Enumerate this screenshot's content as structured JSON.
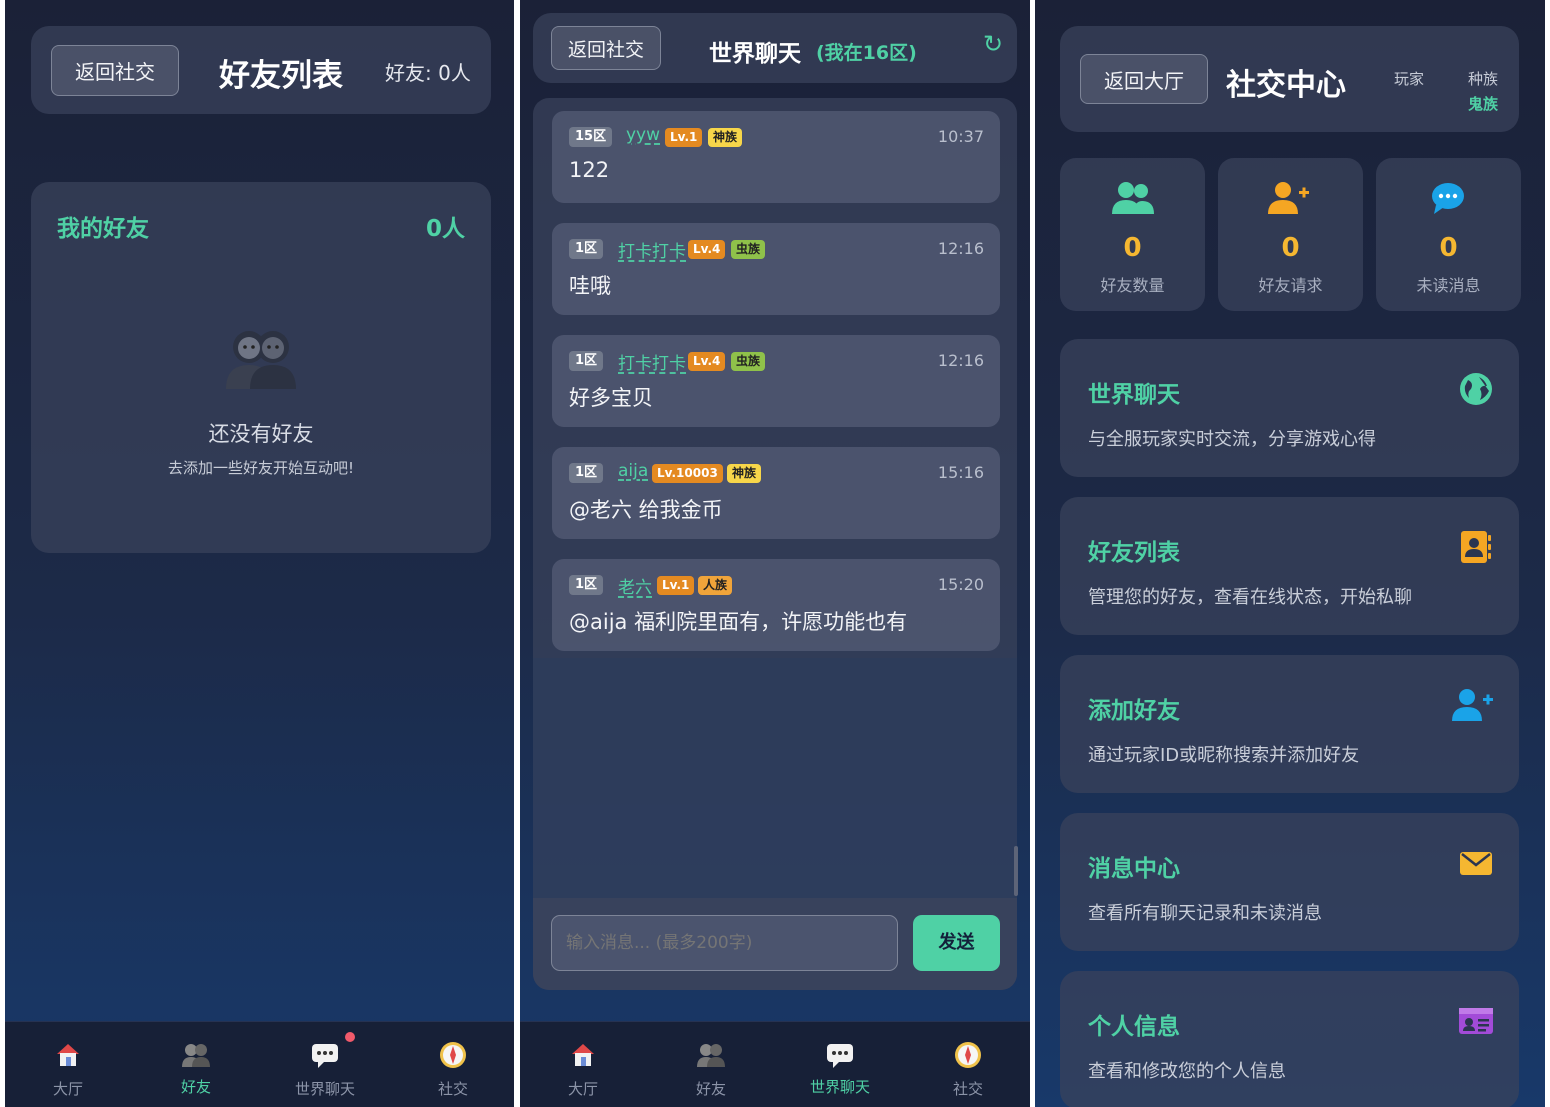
{
  "friends_panel": {
    "back_label": "返回社交",
    "title": "好友列表",
    "count_label": "好友: 0人",
    "section_title": "我的好友",
    "section_count": "0人",
    "empty_title": "还没有好友",
    "empty_hint": "去添加一些好友开始互动吧!"
  },
  "chat_panel": {
    "back_label": "返回社交",
    "title": "世界聊天",
    "zone_label": "(我在16区)",
    "refresh_icon": "↻",
    "messages": [
      {
        "zone": "15区",
        "user": "yyw",
        "level": "Lv.1",
        "race": "神族",
        "time": "10:37",
        "text": "122"
      },
      {
        "zone": "1区",
        "user": "打卡打卡",
        "level": "Lv.4",
        "race": "虫族",
        "time": "12:16",
        "text": "哇哦"
      },
      {
        "zone": "1区",
        "user": "打卡打卡",
        "level": "Lv.4",
        "race": "虫族",
        "time": "12:16",
        "text": "好多宝贝"
      },
      {
        "zone": "1区",
        "user": "aija",
        "level": "Lv.10003",
        "race": "神族",
        "time": "15:16",
        "text": "@老六 给我金币"
      },
      {
        "zone": "1区",
        "user": "老六",
        "level": "Lv.1",
        "race": "人族",
        "time": "15:20",
        "text": "@aija 福利院里面有，许愿功能也有"
      }
    ],
    "input_placeholder": "输入消息... (最多200字)",
    "send_label": "发送"
  },
  "social_panel": {
    "back_label": "返回大厅",
    "title": "社交中心",
    "player_label": "玩家",
    "race_label": "种族",
    "race_value": "鬼族",
    "stats": [
      {
        "value": "0",
        "label": "好友数量",
        "icon": "users-icon"
      },
      {
        "value": "0",
        "label": "好友请求",
        "icon": "user-plus-icon"
      },
      {
        "value": "0",
        "label": "未读消息",
        "icon": "chat-bubble-icon"
      }
    ],
    "features": [
      {
        "title": "世界聊天",
        "desc": "与全服玩家实时交流，分享游戏心得",
        "icon": "globe-icon"
      },
      {
        "title": "好友列表",
        "desc": "管理您的好友，查看在线状态，开始私聊",
        "icon": "address-book-icon"
      },
      {
        "title": "添加好友",
        "desc": "通过玩家ID或昵称搜索并添加好友",
        "icon": "user-plus-icon"
      },
      {
        "title": "消息中心",
        "desc": "查看所有聊天记录和未读消息",
        "icon": "envelope-icon"
      },
      {
        "title": "个人信息",
        "desc": "查看和修改您的个人信息",
        "icon": "id-card-icon"
      }
    ]
  },
  "nav": {
    "items": [
      {
        "label": "大厅",
        "icon": "house-icon"
      },
      {
        "label": "好友",
        "icon": "friends-icon"
      },
      {
        "label": "世界聊天",
        "icon": "chat-icon"
      },
      {
        "label": "社交",
        "icon": "compass-icon"
      }
    ]
  },
  "colors": {
    "accent": "#4fd1a5",
    "stat_number": "#f5b731",
    "level_badge": "#e48a21",
    "race_shen": "#f7d64a",
    "race_chong": "#8fc14a",
    "race_ren": "#f0a43a",
    "notification_dot": "#f15a6b"
  }
}
